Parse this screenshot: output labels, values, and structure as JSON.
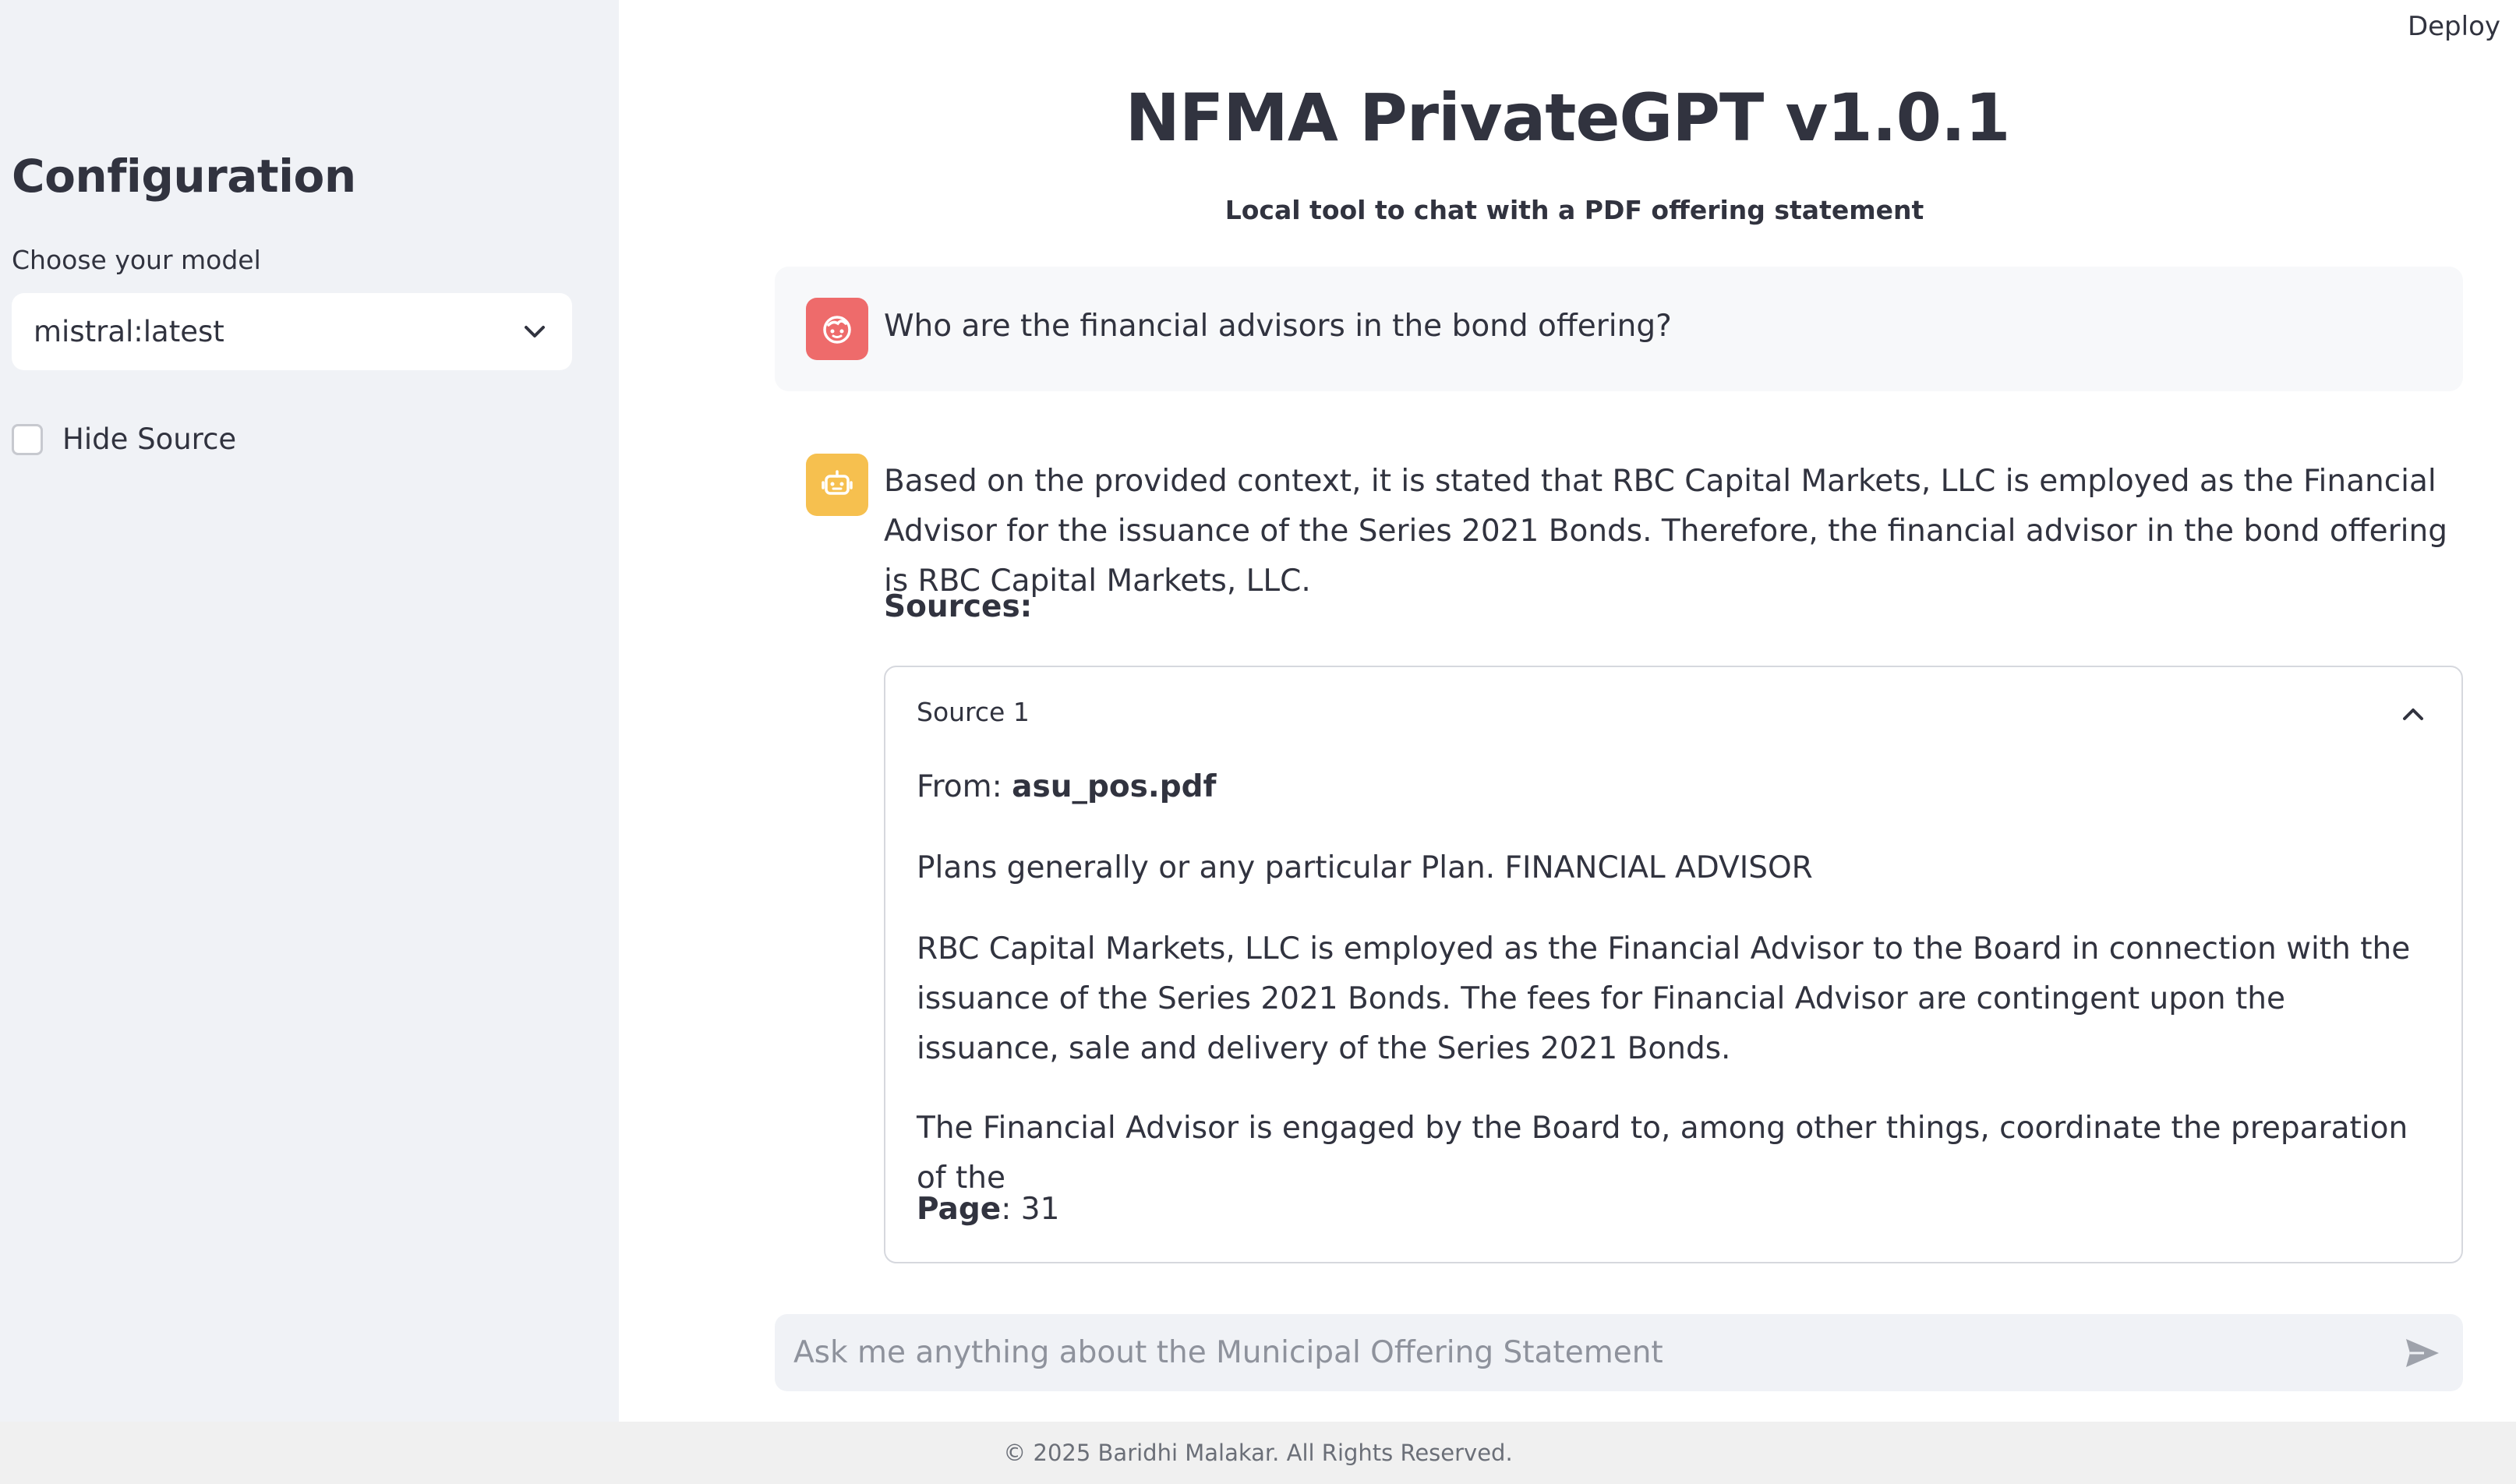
{
  "header": {
    "deploy_label": "Deploy"
  },
  "sidebar": {
    "title": "Configuration",
    "model_label": "Choose your model",
    "model_value": "mistral:latest",
    "hide_source_label": "Hide Source",
    "hide_source_checked": false
  },
  "main": {
    "title": "NFMA PrivateGPT v1.0.1",
    "subtitle": "Local tool to chat with a PDF offering statement"
  },
  "chat": {
    "user_message": "Who are the financial advisors in the bond offering?",
    "assistant_message": "Based on the provided context, it is stated that RBC Capital Markets, LLC is employed as the Financial Advisor for the issuance of the Series 2021 Bonds. Therefore, the financial advisor in the bond offering is RBC Capital Markets, LLC.",
    "sources_label": "Sources:",
    "source": {
      "header": "Source 1",
      "from_label": "From: ",
      "from_value": "asu_pos.pdf",
      "paragraph1": "Plans generally or any particular Plan. FINANCIAL ADVISOR",
      "paragraph2": "RBC Capital Markets, LLC is employed as the Financial Advisor to the Board in connection with the issuance of the Series 2021 Bonds. The fees for Financial Advisor are contingent upon the issuance, sale and delivery of the Series 2021 Bonds.",
      "paragraph3": "The Financial Advisor is engaged by the Board to, among other things, coordinate the preparation of the",
      "page_label": "Page",
      "page_value": ": 31"
    }
  },
  "input": {
    "placeholder": "Ask me anything about the Municipal Offering Statement",
    "value": ""
  },
  "footer": {
    "text": "© 2025 Baridhi Malakar. All Rights Reserved."
  },
  "icons": {
    "user_avatar": "user-face-icon",
    "bot_avatar": "robot-icon",
    "select_chevron": "chevron-down-icon",
    "collapse": "chevron-up-icon",
    "send": "send-icon"
  },
  "colors": {
    "sidebar_bg": "#f0f2f6",
    "user_avatar_bg": "#ee6b6b",
    "bot_avatar_bg": "#f6c04f",
    "text": "#31333f"
  }
}
